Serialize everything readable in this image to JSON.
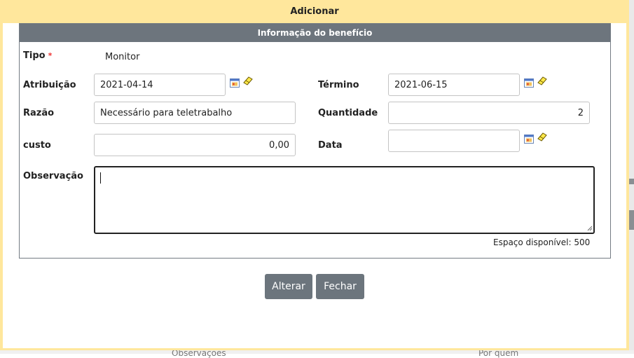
{
  "dialog": {
    "title": "Adicionar",
    "section_title": "Informação do benefício"
  },
  "form": {
    "tipo": {
      "label": "Tipo",
      "required_mark": "*",
      "value": "Monitor"
    },
    "atribuicao": {
      "label": "Atribuição",
      "value": "2021-04-14"
    },
    "termino": {
      "label": "Término",
      "value": "2021-06-15"
    },
    "razao": {
      "label": "Razão",
      "value": "Necessário para teletrabalho"
    },
    "quantidade": {
      "label": "Quantidade",
      "value": "2"
    },
    "custo": {
      "label": "custo",
      "value": "0,00"
    },
    "data": {
      "label": "Data",
      "value": ""
    },
    "observacao": {
      "label": "Observação",
      "value": ""
    },
    "remaining_text": "Espaço disponível: 500"
  },
  "buttons": {
    "alterar": "Alterar",
    "fechar": "Fechar"
  },
  "background_text": {
    "left": "Observações",
    "right": "Por quem"
  },
  "icons": {
    "calendar": "calendar-icon",
    "clear": "eraser-icon"
  },
  "colors": {
    "dialog_background": "#ffe79c",
    "section_header": "#6d757d",
    "button": "#6c757d",
    "required": "#ee3333"
  }
}
